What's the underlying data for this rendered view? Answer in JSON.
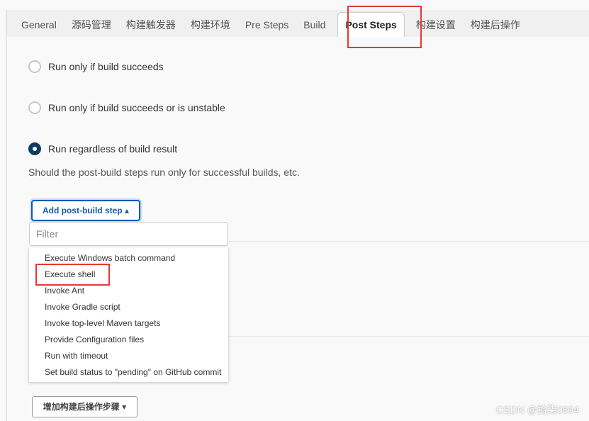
{
  "tabs": [
    "General",
    "源码管理",
    "构建触发器",
    "构建环境",
    "Pre Steps",
    "Build",
    "Post Steps",
    "构建设置",
    "构建后操作"
  ],
  "active_tab": "Post Steps",
  "options": [
    {
      "label": "Run only if build succeeds",
      "selected": false
    },
    {
      "label": "Run only if build succeeds or is unstable",
      "selected": false
    },
    {
      "label": "Run regardless of build result",
      "selected": true
    }
  ],
  "description": "Should the post-build steps run only for successful builds, etc.",
  "add_button": {
    "label": "Add post-build step",
    "icon": "caret-up-icon"
  },
  "filter": {
    "placeholder": "Filter",
    "value": ""
  },
  "menu_items": [
    "Execute Windows batch command",
    "Execute shell",
    "Invoke Ant",
    "Invoke Gradle script",
    "Invoke top-level Maven targets",
    "Provide Configuration files",
    "Run with timeout",
    "Set build status to \"pending\" on GitHub commit"
  ],
  "highlighted_item": "Execute shell",
  "post_build_button": {
    "label": "增加构建后操作步骤",
    "icon": "caret-down-icon"
  },
  "watermark": "CSDN @拾柒0804",
  "colors": {
    "accent": "#1459b5",
    "highlight": "#e53935",
    "radio_selected": "#0a3d62"
  }
}
